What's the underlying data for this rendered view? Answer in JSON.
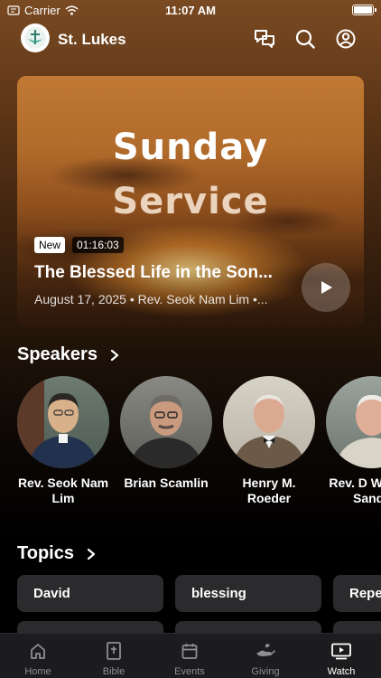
{
  "status_bar": {
    "carrier": "Carrier",
    "time": "11:07 AM"
  },
  "header": {
    "church_name": "St. Lukes",
    "icons": [
      "chat-icon",
      "search-icon",
      "profile-icon"
    ]
  },
  "hero": {
    "title_line1": "Sunday",
    "title_line2": "Service",
    "badge": "New",
    "duration": "01:16:03",
    "sermon_title": "The Blessed Life in the Son...",
    "meta": "August 17, 2025 • Rev. Seok Nam Lim •..."
  },
  "speakers": {
    "title": "Speakers",
    "items": [
      {
        "name": "Rev. Seok Nam Lim"
      },
      {
        "name": "Brian Scamlin"
      },
      {
        "name": "Henry M. Roeder"
      },
      {
        "name": "Rev. D William Sande"
      }
    ]
  },
  "topics": {
    "title": "Topics",
    "items": [
      "David",
      "blessing",
      "Repe"
    ]
  },
  "tabbar": {
    "active": "Watch",
    "items": [
      {
        "label": "Home",
        "icon": "home-icon"
      },
      {
        "label": "Bible",
        "icon": "bible-icon"
      },
      {
        "label": "Events",
        "icon": "calendar-icon"
      },
      {
        "label": "Giving",
        "icon": "giving-icon"
      },
      {
        "label": "Watch",
        "icon": "watch-icon"
      }
    ]
  },
  "colors": {
    "background_top": "#7a4a22",
    "chip": "#2b2b2d",
    "tabbar": "#1c1c1e",
    "inactive_tab": "#8e8e93"
  }
}
